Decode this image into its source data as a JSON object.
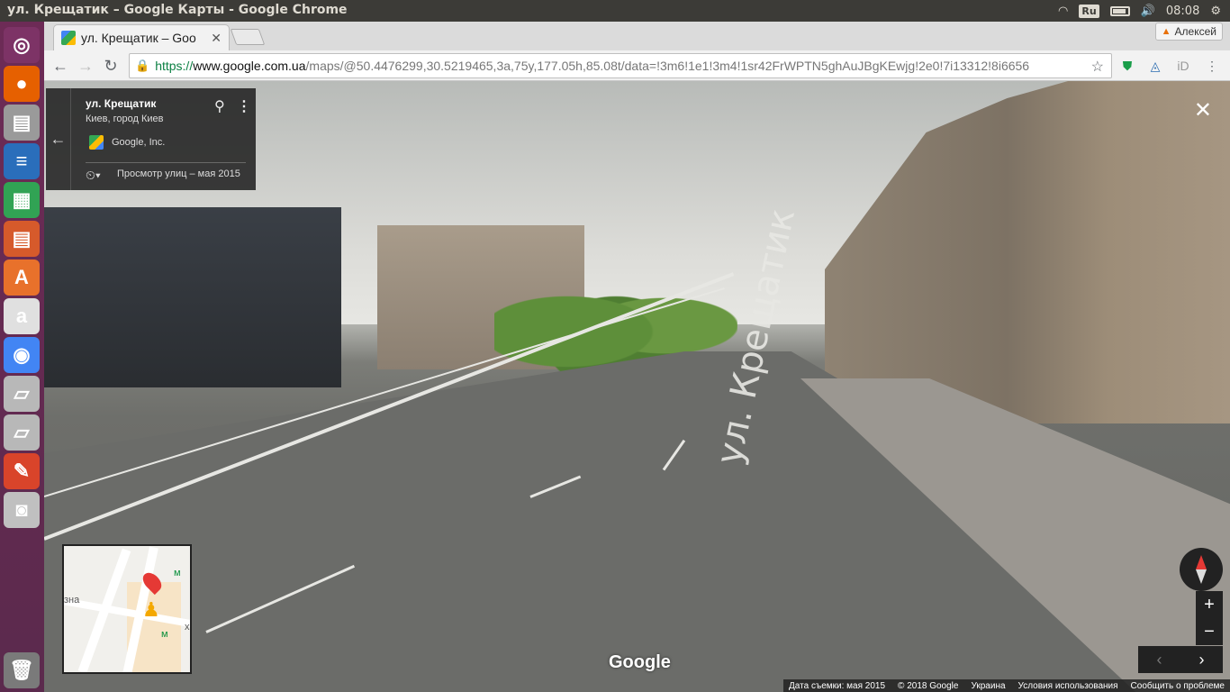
{
  "os": {
    "window_title": "ул. Крещатик – Google Карты - Google Chrome",
    "keyboard_layout": "Ru",
    "time": "08:08"
  },
  "launcher": {
    "items": [
      {
        "name": "ubuntu-dash",
        "glyph": "◎",
        "color": "#7d3366"
      },
      {
        "name": "firefox",
        "glyph": "●",
        "color": "#e66000"
      },
      {
        "name": "files",
        "glyph": "▤",
        "color": "#9a9a9a"
      },
      {
        "name": "writer",
        "glyph": "≡",
        "color": "#2a6ebb"
      },
      {
        "name": "calc",
        "glyph": "▦",
        "color": "#31a354"
      },
      {
        "name": "impress",
        "glyph": "▤",
        "color": "#d65a2b"
      },
      {
        "name": "software-center",
        "glyph": "A",
        "color": "#e8712b"
      },
      {
        "name": "amazon",
        "glyph": "a",
        "color": "#e0e0e0"
      },
      {
        "name": "chrome",
        "glyph": "◉",
        "color": "#4285f4"
      },
      {
        "name": "drive-1",
        "glyph": "▱",
        "color": "#b8b8b8"
      },
      {
        "name": "drive-2",
        "glyph": "▱",
        "color": "#b8b8b8"
      },
      {
        "name": "settings",
        "glyph": "✎",
        "color": "#d9442a"
      },
      {
        "name": "screenshot",
        "glyph": "◙",
        "color": "#c0c0c0"
      },
      {
        "name": "trash",
        "glyph": "🗑",
        "color": "#7a7a7a"
      }
    ]
  },
  "browser": {
    "tab_title": "ул. Крещатик – Goo",
    "profile_name": "Алексей",
    "url_scheme": "https://",
    "url_host": "www.google.com.ua",
    "url_rest": "/maps/@50.4476299,30.5219465,3a,75y,177.05h,85.08t/data=!3m6!1e1!3m4!1sr42FrWPTN5ghAuJBgKEwjg!2e0!7i13312!8i6656"
  },
  "streetview": {
    "place_name": "ул. Крещатик",
    "place_sub": "Киев, город Киев",
    "provider": "Google, Inc.",
    "history_text": "Просмотр улиц – мая 2015",
    "road_text": "ул. Крещатик",
    "google_logo": "Google",
    "zoom_in": "+",
    "zoom_out": "−",
    "minimap_labels": [
      "зна",
      "м",
      "м",
      "х"
    ]
  },
  "footer": {
    "capture_date": "Дата съемки: мая 2015",
    "copyright": "© 2018 Google",
    "country": "Украина",
    "terms": "Условия использования",
    "report": "Сообщить о проблеме"
  }
}
